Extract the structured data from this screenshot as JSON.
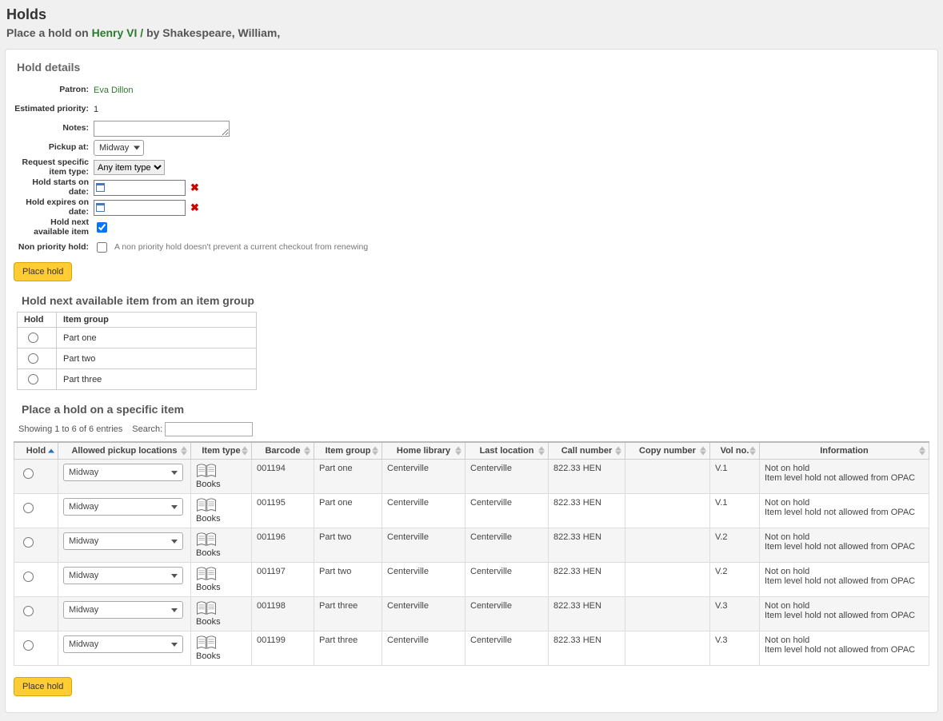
{
  "header": {
    "title": "Holds",
    "subtitle_prefix": "Place a hold on ",
    "subtitle_title": "Henry VI /",
    "subtitle_suffix": " by Shakespeare, William,"
  },
  "details": {
    "section_title": "Hold details",
    "labels": {
      "patron": "Patron:",
      "priority": "Estimated priority:",
      "notes": "Notes:",
      "pickup": "Pickup at:",
      "itemtype": "Request specific item type:",
      "starts": "Hold starts on date:",
      "expires": "Hold expires on date:",
      "next": "Hold next available item",
      "nonpriority": "Non priority hold:"
    },
    "patron_name": "Eva Dillon",
    "priority_value": "1",
    "notes_value": "",
    "pickup_value": "Midway",
    "itemtype_value": "Any item type",
    "hold_next_checked": true,
    "nonpriority_hint": "A non priority hold doesn't prevent a current checkout from renewing"
  },
  "buttons": {
    "place_hold": "Place hold"
  },
  "group_section": {
    "title": "Hold next available item from an item group",
    "headers": {
      "hold": "Hold",
      "group": "Item group"
    },
    "rows": [
      {
        "label": "Part one"
      },
      {
        "label": "Part two"
      },
      {
        "label": "Part three"
      }
    ]
  },
  "items_section": {
    "title": "Place a hold on a specific item",
    "showing": "Showing 1 to 6 of 6 entries",
    "search_label": "Search:",
    "search_value": "",
    "headers": {
      "hold": "Hold",
      "locations": "Allowed pickup locations",
      "itemtype": "Item type",
      "barcode": "Barcode",
      "itemgroup": "Item group",
      "home": "Home library",
      "last": "Last location",
      "call": "Call number",
      "copy": "Copy number",
      "vol": "Vol no.",
      "info": "Information"
    },
    "item_type_label": "Books",
    "info_line1": "Not on hold",
    "info_line2": "Item level hold not allowed from OPAC",
    "rows": [
      {
        "loc": "Midway",
        "barcode": "001194",
        "group": "Part one",
        "home": "Centerville",
        "last": "Centerville",
        "call": "822.33 HEN",
        "copy": "",
        "vol": "V.1"
      },
      {
        "loc": "Midway",
        "barcode": "001195",
        "group": "Part one",
        "home": "Centerville",
        "last": "Centerville",
        "call": "822.33 HEN",
        "copy": "",
        "vol": "V.1"
      },
      {
        "loc": "Midway",
        "barcode": "001196",
        "group": "Part two",
        "home": "Centerville",
        "last": "Centerville",
        "call": "822.33 HEN",
        "copy": "",
        "vol": "V.2"
      },
      {
        "loc": "Midway",
        "barcode": "001197",
        "group": "Part two",
        "home": "Centerville",
        "last": "Centerville",
        "call": "822.33 HEN",
        "copy": "",
        "vol": "V.2"
      },
      {
        "loc": "Midway",
        "barcode": "001198",
        "group": "Part three",
        "home": "Centerville",
        "last": "Centerville",
        "call": "822.33 HEN",
        "copy": "",
        "vol": "V.3"
      },
      {
        "loc": "Midway",
        "barcode": "001199",
        "group": "Part three",
        "home": "Centerville",
        "last": "Centerville",
        "call": "822.33 HEN",
        "copy": "",
        "vol": "V.3"
      }
    ]
  }
}
